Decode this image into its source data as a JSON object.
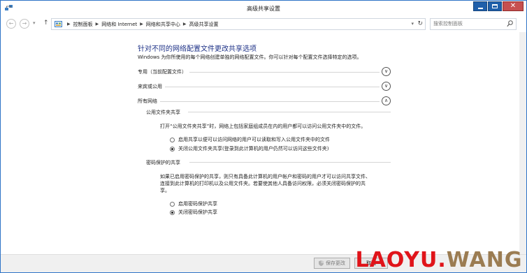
{
  "window": {
    "title": "高级共享设置"
  },
  "address_bar": {
    "breadcrumbs": [
      "控制面板",
      "网络和 Internet",
      "网络和共享中心",
      "高级共享设置"
    ],
    "search_placeholder": "搜索控制面板"
  },
  "main": {
    "heading": "针对不同的网络配置文件更改共享选项",
    "description": "Windows 为你所使用的每个网络创建单独的网络配置文件。你可以针对每个配置文件选择特定的选项。",
    "profiles": [
      {
        "label": "专用（当前配置文件）",
        "expanded": false
      },
      {
        "label": "来宾或公用",
        "expanded": false
      },
      {
        "label": "所有网络",
        "expanded": true
      }
    ],
    "public_folder": {
      "title": "公用文件夹共享",
      "description": "打开“公用文件夹共享”时，网络上包括家庭组成员在内的用户都可以访问公用文件夹中的文件。",
      "options": [
        {
          "label": "启用共享以便可以访问网络的用户可以读取和写入公用文件夹中的文件",
          "checked": false
        },
        {
          "label": "关闭公用文件夹共享(登录到此计算机的用户仍然可以访问这些文件夹)",
          "checked": true
        }
      ]
    },
    "password_protected": {
      "title": "密码保护的共享",
      "description_lines": [
        "如果已启用密码保护的共享，则只有具备此计算机的用户帐户和密码的用户才可以访问共享文件、",
        "连接到此计算机的打印机以及公用文件夹。若要使其他人具备访问权限，必须关闭密码保护的共",
        "享。"
      ],
      "options": [
        {
          "label": "启用密码保护共享",
          "checked": false
        },
        {
          "label": "关闭密码保护共享",
          "checked": true
        }
      ]
    }
  },
  "footer": {
    "save_label": "保存更改",
    "cancel_label": "取消"
  },
  "watermark": {
    "part1": "LAOYU.",
    "part2": "WANG"
  },
  "colors": {
    "accent": "#1f5faa",
    "close": "#c75050",
    "heading": "#1e3287",
    "wm_red": "#e0141a",
    "wm_brown": "#9b7c52"
  }
}
